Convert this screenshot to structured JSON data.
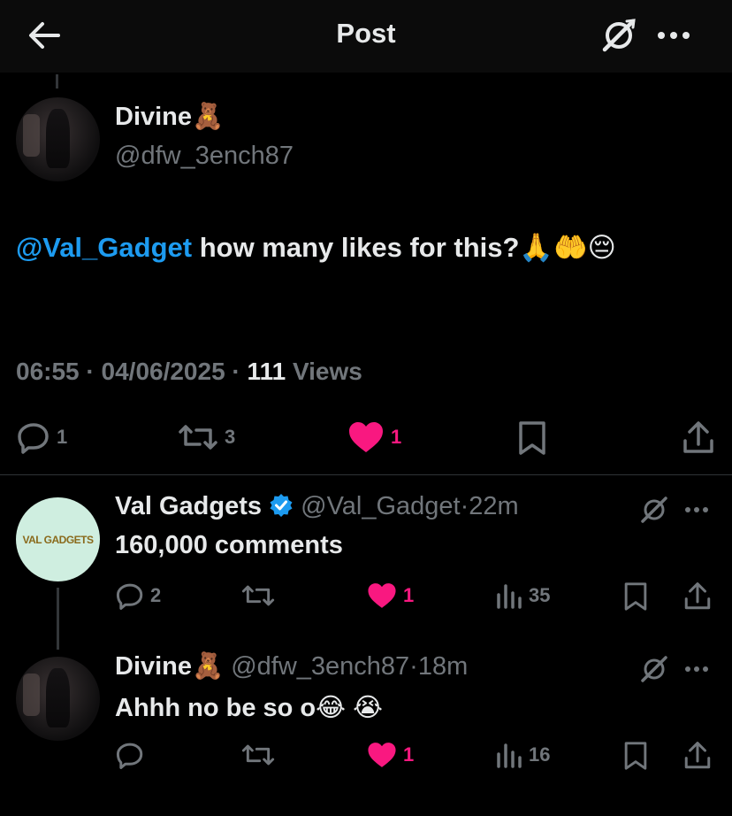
{
  "header": {
    "title": "Post"
  },
  "main_post": {
    "author_name": "Divine🧸",
    "handle": "@dfw_3ench87",
    "mention": "@Val_Gadget",
    "text": " how many likes for this?🙏🤲😔",
    "time": "06:55",
    "date": "04/06/2025",
    "views_count": "111",
    "views_label": "Views",
    "replies": "1",
    "reposts": "3",
    "likes": "1"
  },
  "replies": [
    {
      "author_name": "Val Gadgets",
      "verified": true,
      "handle": "@Val_Gadget",
      "time": "22m",
      "text": "160,000 comments",
      "replies": "2",
      "reposts": "",
      "likes": "1",
      "views": "35",
      "avatar_logo": "VAL GADGETS"
    },
    {
      "author_name": "Divine🧸",
      "verified": false,
      "handle": "@dfw_3ench87",
      "time": "18m",
      "text": "Ahhh no be so o😂 😭",
      "replies": "",
      "reposts": "",
      "likes": "1",
      "views": "16"
    }
  ],
  "colors": {
    "background": "#000000",
    "text": "#e7e9ea",
    "muted": "#71767b",
    "mention": "#1d9bf0",
    "like": "#f91880",
    "verified": "#1d9bf0"
  },
  "icons": {
    "back": "arrow-left-icon",
    "grok": "grok-icon",
    "more": "more-dots-icon",
    "reply": "reply-bubble-icon",
    "repost": "repost-icon",
    "like": "heart-filled-icon",
    "bookmark": "bookmark-icon",
    "share": "share-icon",
    "views": "views-bar-icon"
  }
}
